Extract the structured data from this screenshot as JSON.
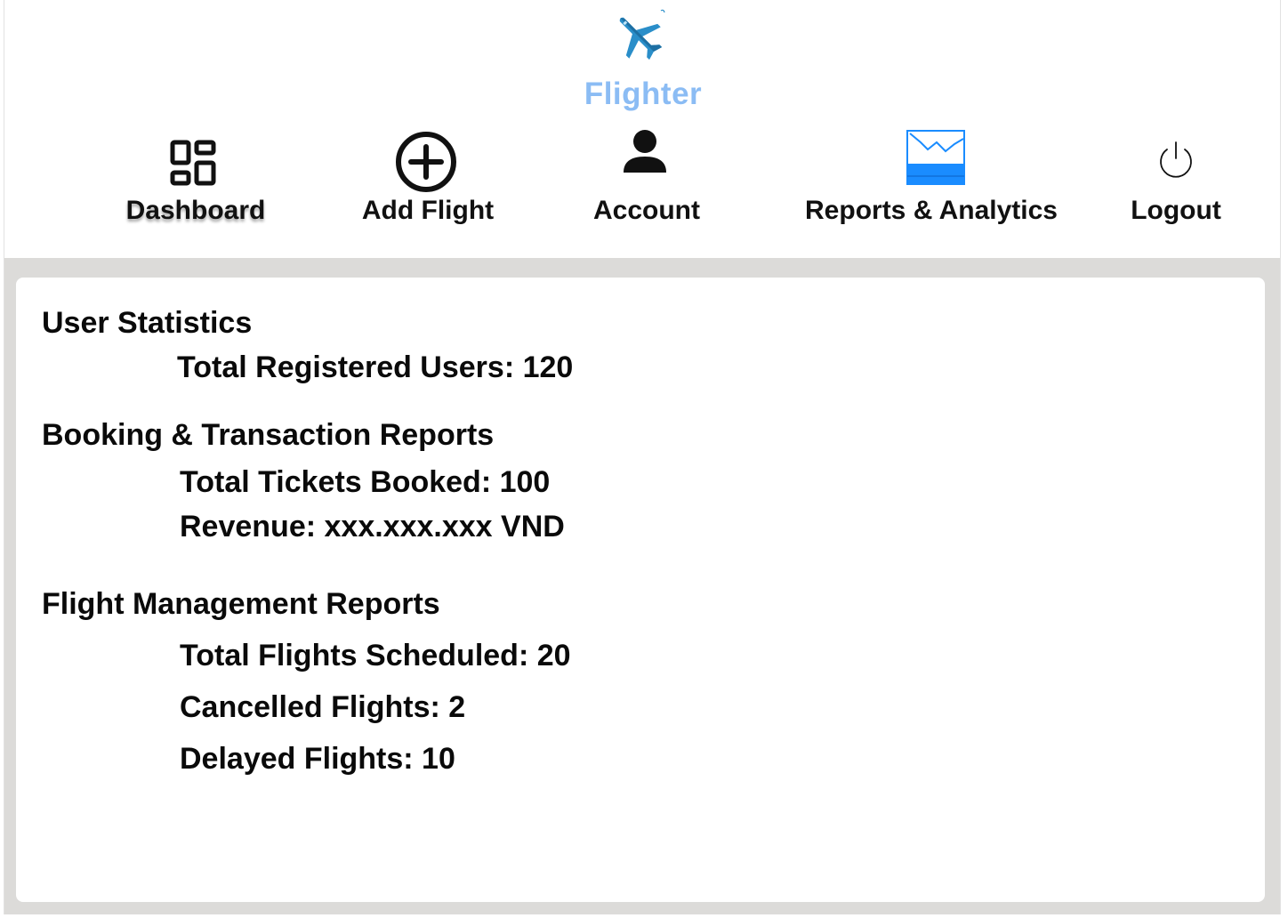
{
  "app": {
    "brand": "Flighter",
    "logo_icon": "airplane-icon",
    "brand_color": "#8bbcf4"
  },
  "nav": {
    "items": [
      {
        "label": "Dashboard",
        "icon": "dashboard-grid-icon",
        "active": true
      },
      {
        "label": "Add Flight",
        "icon": "plus-circle-icon"
      },
      {
        "label": "Account",
        "icon": "user-icon"
      },
      {
        "label": "Reports & Analytics",
        "icon": "analytics-chart-icon"
      },
      {
        "label": "Logout",
        "icon": "power-icon"
      }
    ]
  },
  "report": {
    "user_stats": {
      "title": "User Statistics",
      "total_users": "Total Registered Users: 120"
    },
    "booking": {
      "title": "Booking & Transaction Reports",
      "tickets": "Total Tickets Booked: 100",
      "revenue": "Revenue: xxx.xxx.xxx VND"
    },
    "flights": {
      "title": "Flight Management Reports",
      "scheduled": "Total Flights Scheduled: 20",
      "cancelled": "Cancelled Flights: 2",
      "delayed": "Delayed Flights: 10"
    }
  }
}
